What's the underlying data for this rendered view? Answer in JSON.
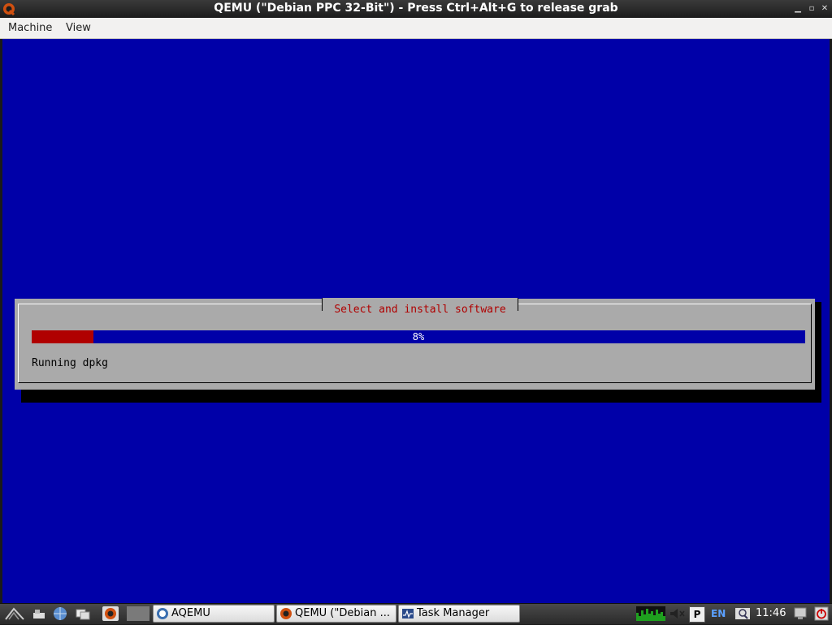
{
  "window": {
    "title": "QEMU (\"Debian PPC 32-Bit\") - Press Ctrl+Alt+G to release grab"
  },
  "menubar": {
    "items": [
      {
        "label": "Machine"
      },
      {
        "label": "View"
      }
    ]
  },
  "screen": {
    "background": "#0000a8",
    "dialog": {
      "title": "Select and install software",
      "progress_percent": 8,
      "progress_text": "8%",
      "status": "Running dpkg"
    }
  },
  "taskbar": {
    "tasks": [
      {
        "label": "AQEMU",
        "icon": "aqemu-icon"
      },
      {
        "label": "QEMU (\"Debian ...",
        "icon": "qemu-icon"
      },
      {
        "label": "Task Manager",
        "icon": "task-manager-icon"
      }
    ],
    "tray": {
      "language": "EN",
      "clock": "11:46"
    }
  }
}
